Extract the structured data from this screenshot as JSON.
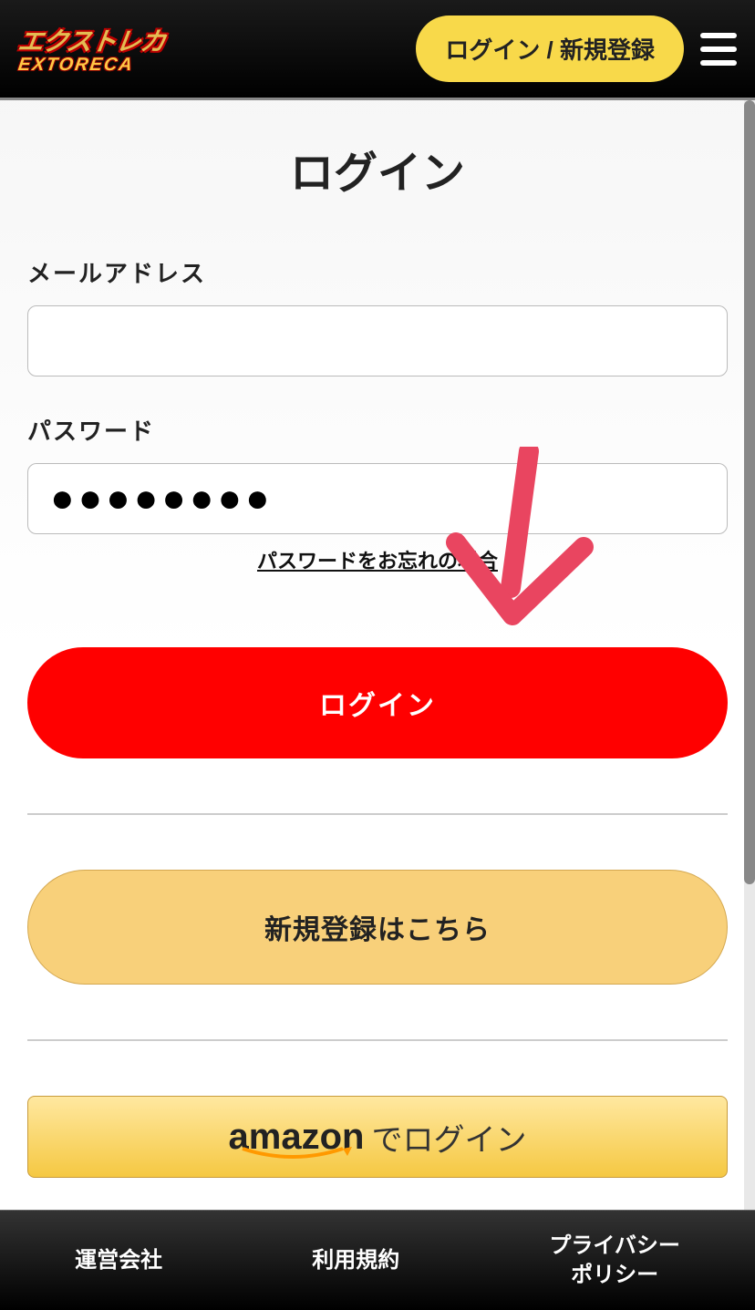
{
  "header": {
    "logo_top": "エクストレカ",
    "logo_bottom": "EXTORECA",
    "login_register_label": "ログイン / 新規登録"
  },
  "page": {
    "title": "ログイン"
  },
  "form": {
    "email_label": "メールアドレス",
    "email_value": "",
    "password_label": "パスワード",
    "password_masked": "●●●●●●●●",
    "forgot_password": "パスワードをお忘れの場合",
    "login_button": "ログイン",
    "register_button": "新規登録はこちら",
    "amazon_brand": "amazon",
    "amazon_login_text": "でログイン"
  },
  "footer": {
    "company": "運営会社",
    "terms": "利用規約",
    "privacy": "プライバシー\nポリシー"
  }
}
